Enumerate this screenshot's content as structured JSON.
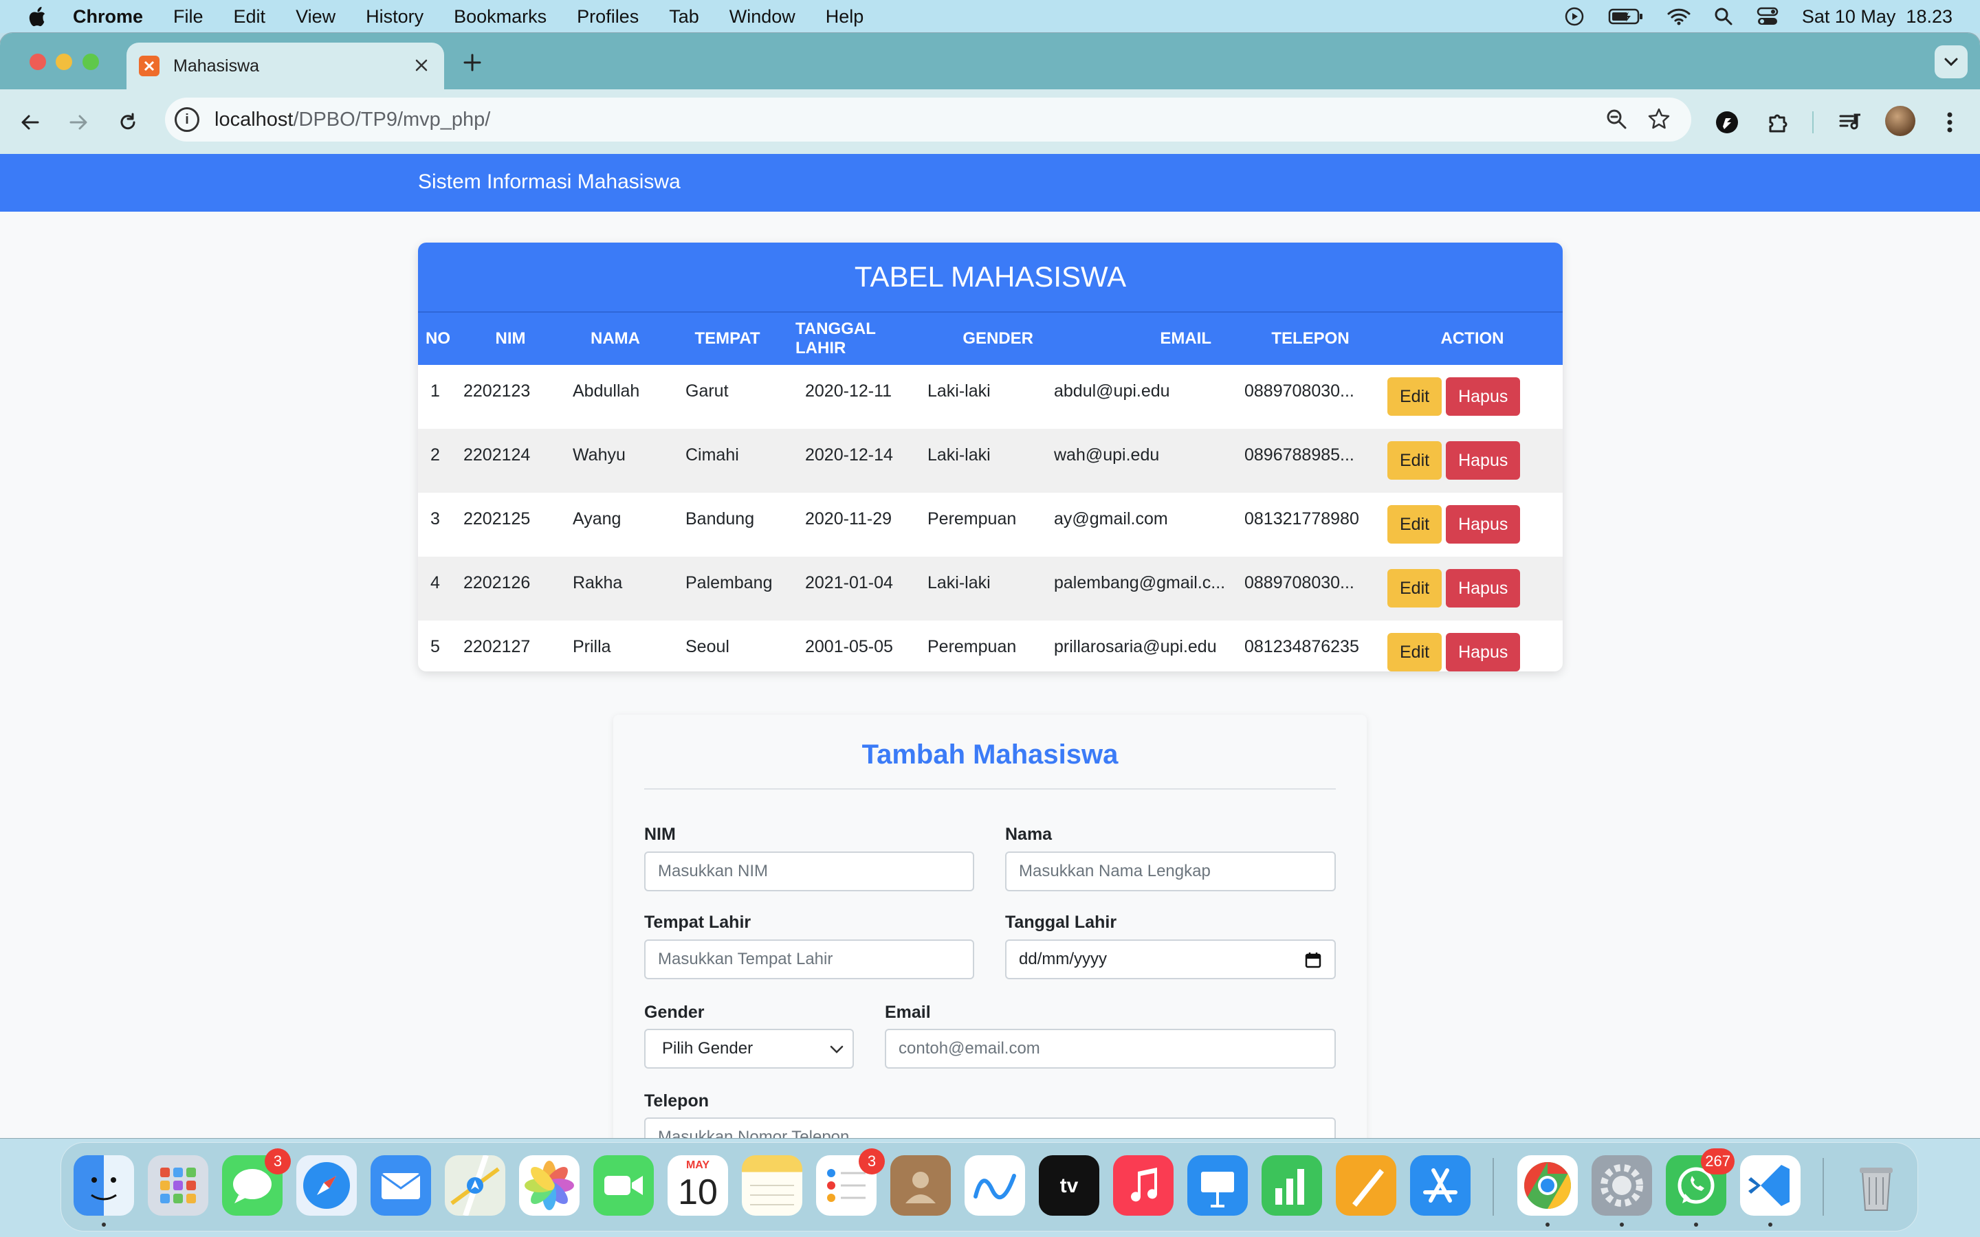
{
  "menubar": {
    "app": "Chrome",
    "items": [
      "File",
      "Edit",
      "View",
      "History",
      "Bookmarks",
      "Profiles",
      "Tab",
      "Window",
      "Help"
    ],
    "clock": "Sat 10 May  18.23"
  },
  "browser": {
    "tab_title": "Mahasiswa",
    "url_host": "localhost",
    "url_path": "/DPBO/TP9/mvp_php/"
  },
  "navbar": {
    "brand": "Sistem Informasi Mahasiswa"
  },
  "table": {
    "caption": "TABEL MAHASISWA",
    "headers": [
      "NO",
      "NIM",
      "NAMA",
      "TEMPAT",
      "TANGGAL LAHIR",
      "GENDER",
      "EMAIL",
      "TELEPON",
      "ACTION"
    ],
    "rows": [
      [
        "1",
        "2202123",
        "Abdullah",
        "Garut",
        "2020-12-11",
        "Laki-laki",
        "abdul@upi.edu",
        "0889708030..."
      ],
      [
        "2",
        "2202124",
        "Wahyu",
        "Cimahi",
        "2020-12-14",
        "Laki-laki",
        "wah@upi.edu",
        "0896788985..."
      ],
      [
        "3",
        "2202125",
        "Ayang",
        "Bandung",
        "2020-11-29",
        "Perempuan",
        "ay@gmail.com",
        "081321778980"
      ],
      [
        "4",
        "2202126",
        "Rakha",
        "Palembang",
        "2021-01-04",
        "Laki-laki",
        "palembang@gmail.c...",
        "0889708030..."
      ],
      [
        "5",
        "2202127",
        "Prilla",
        "Seoul",
        "2001-05-05",
        "Perempuan",
        "prillarosaria@upi.edu",
        "081234876235"
      ]
    ],
    "edit_label": "Edit",
    "delete_label": "Hapus"
  },
  "form": {
    "title": "Tambah Mahasiswa",
    "nim_label": "NIM",
    "nim_placeholder": "Masukkan NIM",
    "nama_label": "Nama",
    "nama_placeholder": "Masukkan Nama Lengkap",
    "tempat_label": "Tempat Lahir",
    "tempat_placeholder": "Masukkan Tempat Lahir",
    "tanggal_label": "Tanggal Lahir",
    "tanggal_value": "dd/mm/yyyy",
    "gender_label": "Gender",
    "gender_selected": "Pilih Gender",
    "email_label": "Email",
    "email_placeholder": "contoh@email.com",
    "telepon_label": "Telepon",
    "telepon_placeholder": "Masukkan Nomor Telepon"
  },
  "dock": {
    "messages_badge": "3",
    "calendar_month": "MAY",
    "calendar_day": "10",
    "reminders_badge": "3",
    "whatsapp_badge": "267"
  },
  "colors": {
    "primary": "#3b7bf7",
    "warning": "#f5c143",
    "danger": "#d6404f"
  }
}
